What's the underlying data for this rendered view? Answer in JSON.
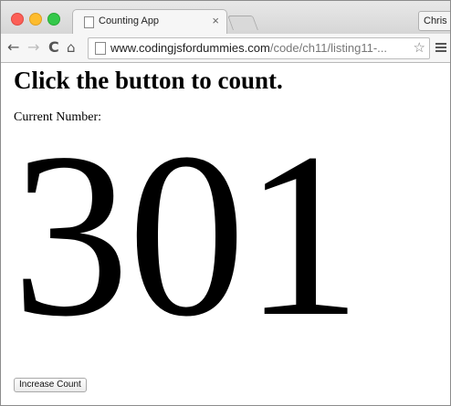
{
  "browser": {
    "tab": {
      "title": "Counting App",
      "close_glyph": "×",
      "icon": "page-icon"
    },
    "profile_name": "Chris",
    "nav": {
      "back_glyph": "←",
      "forward_glyph": "→",
      "reload_glyph": "C",
      "home_glyph": "⌂"
    },
    "address_bar": {
      "url_host": "www.codingjsfordummies.com",
      "url_path": "/code/ch11/listing11-...",
      "bookmark_glyph": "☆"
    },
    "colors": {
      "close": "#fc5f57",
      "minimize": "#fdbc2e",
      "maximize": "#34c84a"
    }
  },
  "page": {
    "heading": "Click the button to count.",
    "label": "Current Number:",
    "count": "301",
    "button_label": "Increase Count"
  }
}
